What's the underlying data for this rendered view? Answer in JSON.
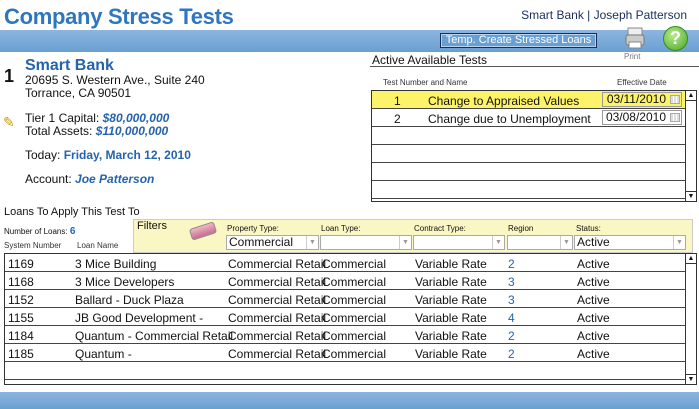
{
  "header": {
    "title": "Company Stress Tests",
    "user_info": "Smart Bank | Joseph Patterson",
    "temp_button": "Temp. Create Stressed Loans",
    "print_label": "Print",
    "help": "?"
  },
  "bank": {
    "number": "1",
    "name": "Smart Bank",
    "address1": "20695 S. Western Ave., Suite 240",
    "address2": "Torrance, CA  90501",
    "tier1_label": "Tier 1 Capital: ",
    "tier1": "$80,000,000",
    "assets_label": "Total Assets: ",
    "assets": "$110,000,000",
    "today_label": "Today: ",
    "today": "Friday, March 12, 2010",
    "account_label": "Account: ",
    "account": "Joe Patterson"
  },
  "tests": {
    "title": "Active Available Tests",
    "col_name": "Test Number and Name",
    "col_date": "Effective Date",
    "rows": [
      {
        "num": "1",
        "name": "Change to Appraised Values",
        "date": "03/11/2010"
      },
      {
        "num": "2",
        "name": "Change due to Unemployment",
        "date": "03/08/2010"
      }
    ]
  },
  "loans": {
    "title": "Loans To Apply This Test To",
    "count_label": "Number of Loans: ",
    "count": "6",
    "col_sys": "System Number",
    "col_name": "Loan Name",
    "filters": {
      "label": "Filters",
      "property_label": "Property Type:",
      "property": "Commercial",
      "loan_label": "Loan Type:",
      "loan": "",
      "contract_label": "Contract Type:",
      "contract": "",
      "region_label": "Region",
      "region": "",
      "status_label": "Status:",
      "status": "Active"
    },
    "rows": [
      {
        "sys": "1169",
        "name": "3 Mice Building",
        "prop": "Commercial Retail",
        "type": "Commercial",
        "contract": "Variable Rate",
        "region": "2",
        "status": "Active"
      },
      {
        "sys": "1168",
        "name": "3 Mice Developers",
        "prop": "Commercial Retail",
        "type": "Commercial",
        "contract": "Variable Rate",
        "region": "3",
        "status": "Active"
      },
      {
        "sys": "1152",
        "name": "Ballard - Duck Plaza",
        "prop": "Commercial Retail",
        "type": "Commercial",
        "contract": "Variable Rate",
        "region": "3",
        "status": "Active"
      },
      {
        "sys": "1155",
        "name": "JB Good Development -",
        "prop": "Commercial Retail",
        "type": "Commercial",
        "contract": "Variable Rate",
        "region": "4",
        "status": "Active"
      },
      {
        "sys": "1184",
        "name": "Quantum - Commercial Retail",
        "prop": "Commercial Retail",
        "type": "Commercial",
        "contract": "Variable Rate",
        "region": "2",
        "status": "Active"
      },
      {
        "sys": "1185",
        "name": "Quantum -",
        "prop": "Commercial Retail",
        "type": "Commercial",
        "contract": "Variable Rate",
        "region": "2",
        "status": "Active"
      }
    ]
  }
}
